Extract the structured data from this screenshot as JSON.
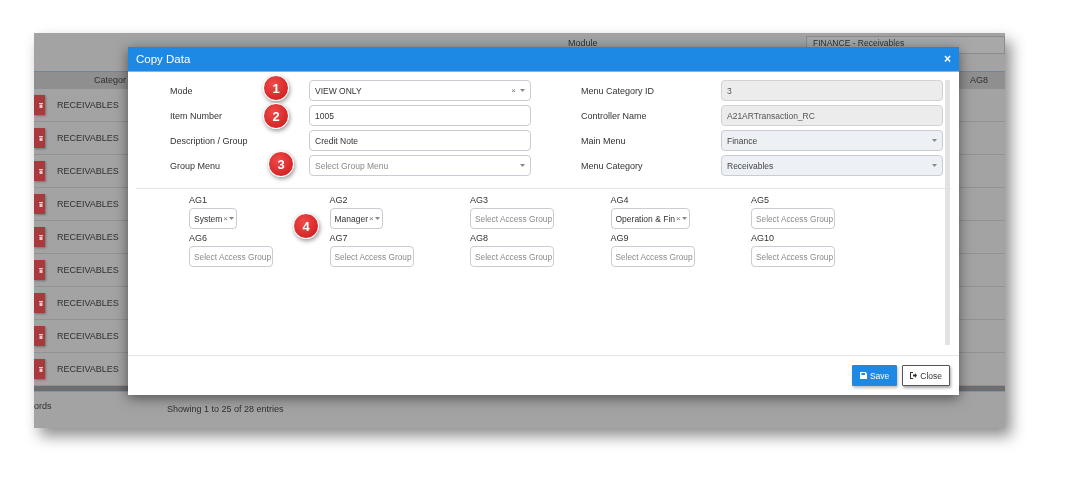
{
  "background": {
    "module_label": "Module",
    "module_value": "FINANCE - Receivables",
    "column_header": "Categor",
    "column_header_2": "AG8",
    "rows": [
      "RECEIVABLES",
      "RECEIVABLES",
      "RECEIVABLES",
      "RECEIVABLES",
      "RECEIVABLES",
      "RECEIVABLES",
      "RECEIVABLES",
      "RECEIVABLES",
      "RECEIVABLES"
    ],
    "records_text": "ords",
    "entries_text": "Showing 1 to 25 of 28 entries"
  },
  "dialog": {
    "title": "Copy Data",
    "close": "×",
    "fields_left": [
      {
        "label": "Mode",
        "kind": "select",
        "value": "VIEW ONLY",
        "clear": "×",
        "disabled": false
      },
      {
        "label": "Item Number",
        "kind": "text",
        "value": "1005",
        "readonly": false
      },
      {
        "label": "Description / Group",
        "kind": "text",
        "value": "Credit Note",
        "readonly": false
      },
      {
        "label": "Group Menu",
        "kind": "select",
        "placeholder": "Select Group Menu",
        "disabled": false
      }
    ],
    "fields_right": [
      {
        "label": "Menu Category ID",
        "kind": "text",
        "value": "3",
        "readonly": true
      },
      {
        "label": "Controller Name",
        "kind": "text",
        "value": "A21ARTransaction_RC",
        "readonly": true
      },
      {
        "label": "Main Menu",
        "kind": "select",
        "value": "Finance",
        "disabled": true
      },
      {
        "label": "Menu Category",
        "kind": "select",
        "value": "Receivables",
        "disabled": true
      }
    ],
    "access_groups": [
      {
        "label": "AG1",
        "value": "System",
        "clear": "×"
      },
      {
        "label": "AG2",
        "value": "Manager",
        "clear": "×"
      },
      {
        "label": "AG3",
        "placeholder": "Select Access Group"
      },
      {
        "label": "AG4",
        "value": "Operation & Fin",
        "clear": "×"
      },
      {
        "label": "AG5",
        "placeholder": "Select Access Group"
      },
      {
        "label": "AG6",
        "placeholder": "Select Access Group"
      },
      {
        "label": "AG7",
        "placeholder": "Select Access Group"
      },
      {
        "label": "AG8",
        "placeholder": "Select Access Group"
      },
      {
        "label": "AG9",
        "placeholder": "Select Access Group"
      },
      {
        "label": "AG10",
        "placeholder": "Select Access Group"
      }
    ],
    "buttons": [
      {
        "label": "Save",
        "kind": "primary"
      },
      {
        "label": "Close",
        "kind": "default"
      }
    ]
  },
  "callouts": [
    "1",
    "2",
    "3",
    "4"
  ]
}
